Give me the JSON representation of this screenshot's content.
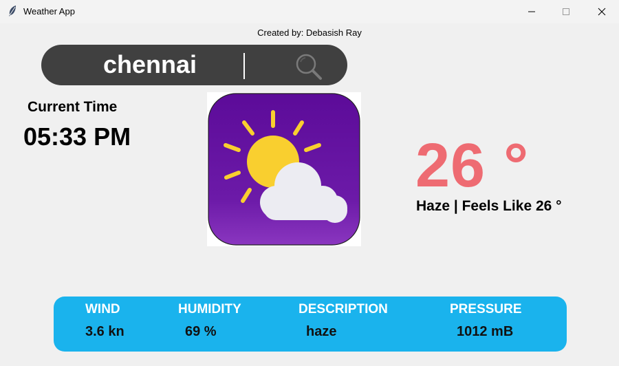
{
  "window": {
    "title": "Weather App",
    "icon": "feather-icon",
    "controls": [
      "minimize-icon",
      "maximize-icon",
      "close-icon"
    ]
  },
  "credit": "Created by: Debasish Ray",
  "search": {
    "value": "chennai",
    "icon": "search-icon"
  },
  "time": {
    "label": "Current Time",
    "value": "05:33 PM"
  },
  "logo": {
    "icon": "sun-cloud-icon",
    "colors": {
      "background": "#6a14a2",
      "sun": "#f9cf2f",
      "cloud": "#ececf2"
    }
  },
  "weather": {
    "temperature": "26 °",
    "condition": "Haze | Feels Like 26 °"
  },
  "info": {
    "wind_label": "WIND",
    "wind_value": "3.6 kn",
    "humidity_label": "HUMIDITY",
    "humidity_value": "69 %",
    "description_label": "DESCRIPTION",
    "description_value": "haze",
    "pressure_label": "PRESSURE",
    "pressure_value": "1012 mB"
  },
  "colors": {
    "background": "#f0f0f0",
    "search_bar": "#404040",
    "temperature": "#ee6b72",
    "info_bar": "#1ab3ed"
  }
}
